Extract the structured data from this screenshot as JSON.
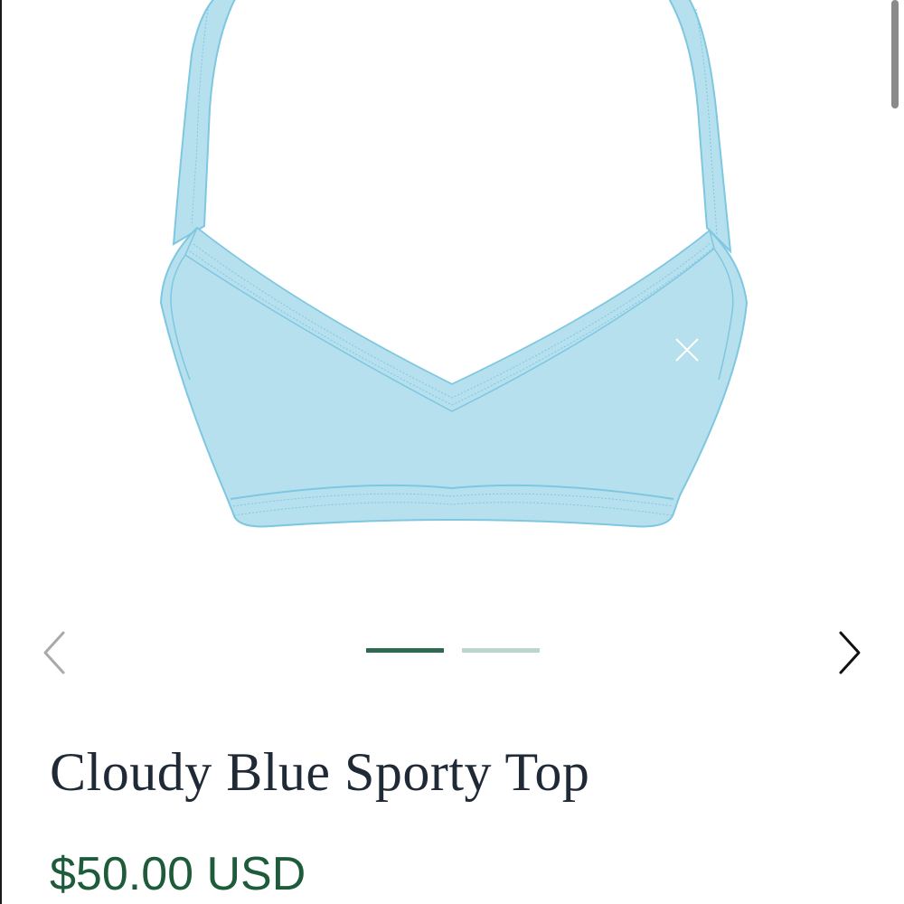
{
  "product": {
    "title": "Cloudy Blue Sporty Top",
    "price": "$50.00 USD",
    "image_description": "cloudy-blue-sporty-top-illustration"
  },
  "carousel": {
    "prev_icon": "chevron-left-icon",
    "next_icon": "chevron-right-icon",
    "slide_count": 2,
    "active_index": 0,
    "active_color": "#2d6a4f",
    "inactive_color": "#b9d6cf",
    "prev_disabled": true
  },
  "colors": {
    "garment_fill": "#b7e0ee",
    "garment_stroke": "#7ec7e0",
    "title": "#1f2a36",
    "price": "#1e5b3a"
  }
}
